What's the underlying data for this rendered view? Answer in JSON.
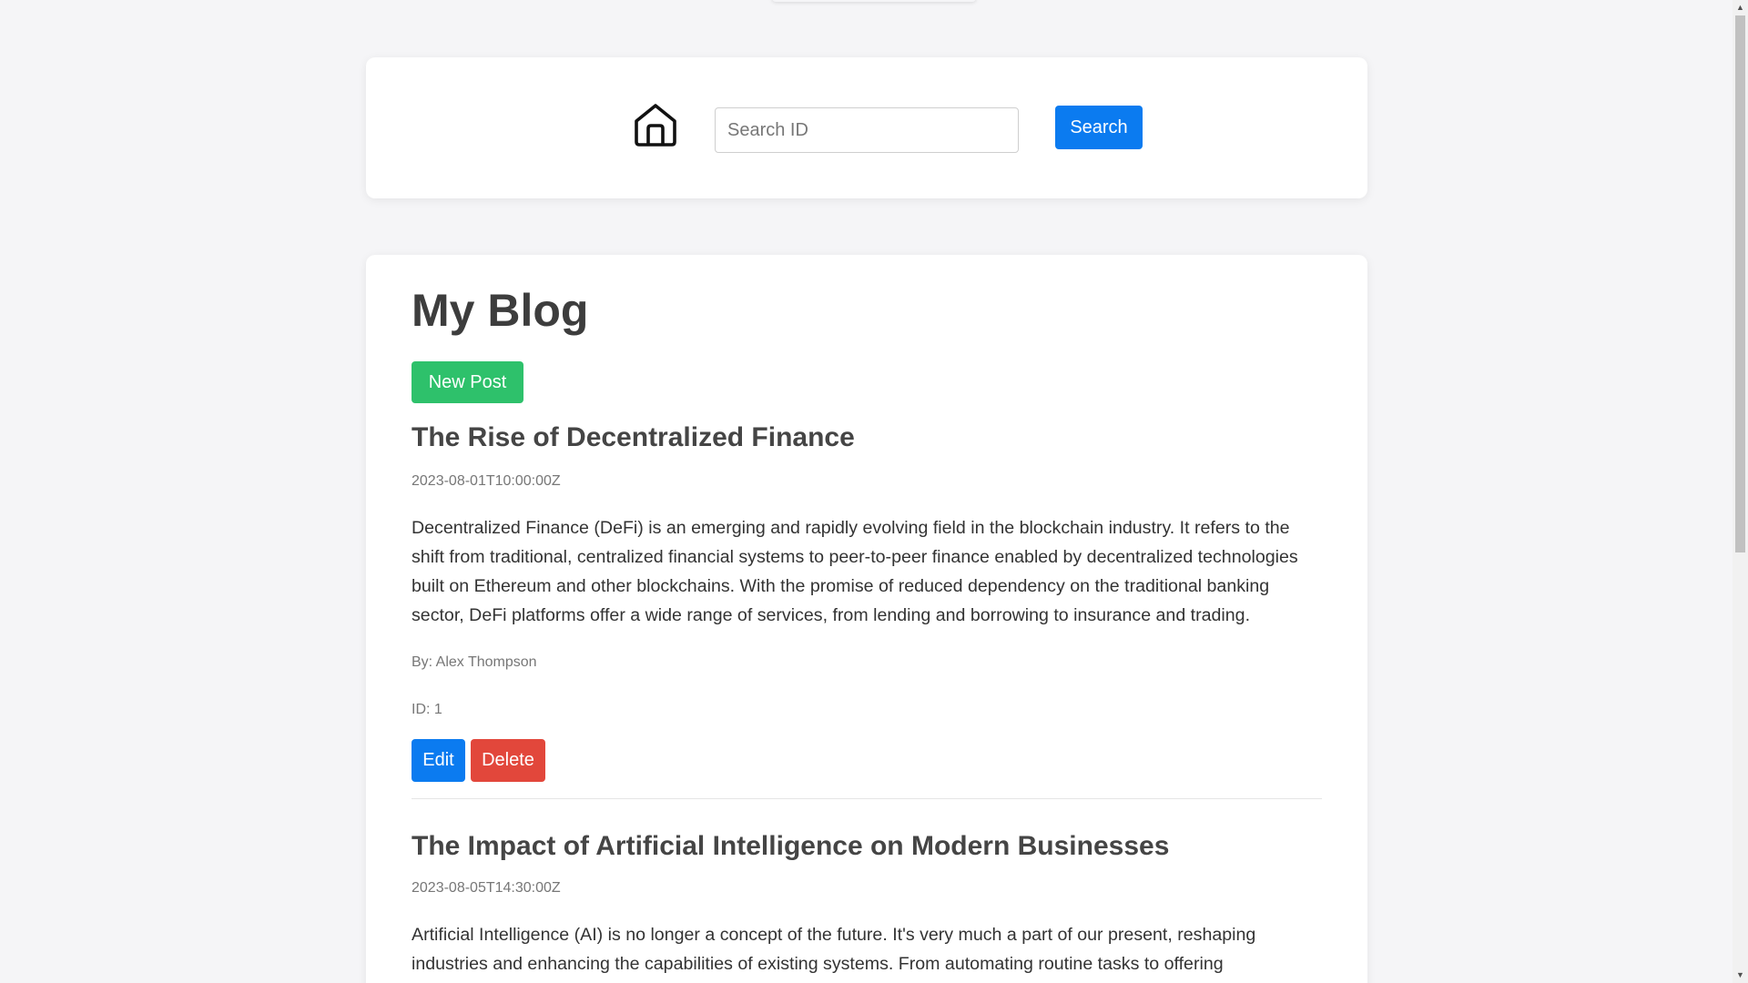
{
  "search": {
    "placeholder": "Search ID",
    "button_label": "Search"
  },
  "blog": {
    "title": "My Blog",
    "new_post_label": "New Post"
  },
  "posts": [
    {
      "title": "The Rise of Decentralized Finance",
      "date": "2023-08-01T10:00:00Z",
      "body": "Decentralized Finance (DeFi) is an emerging and rapidly evolving field in the blockchain industry. It refers to the shift from traditional, centralized financial systems to peer-to-peer finance enabled by decentralized technologies built on Ethereum and other blockchains. With the promise of reduced dependency on the traditional banking sector, DeFi platforms offer a wide range of services, from lending and borrowing to insurance and trading.",
      "author": "By: Alex Thompson",
      "id": "ID: 1",
      "edit_label": "Edit",
      "delete_label": "Delete"
    },
    {
      "title": "The Impact of Artificial Intelligence on Modern Businesses",
      "date": "2023-08-05T14:30:00Z",
      "body": "Artificial Intelligence (AI) is no longer a concept of the future. It's very much a part of our present, reshaping industries and enhancing the capabilities of existing systems. From automating routine tasks to offering"
    }
  ],
  "colors": {
    "primary": "#0b7bf0",
    "success": "#2ec16b",
    "danger": "#e2473b",
    "background": "#f5f5f7"
  },
  "icons": {
    "home": "home-icon",
    "scroll_up": "scroll-up-arrow-icon",
    "scroll_down": "scroll-down-arrow-icon"
  }
}
